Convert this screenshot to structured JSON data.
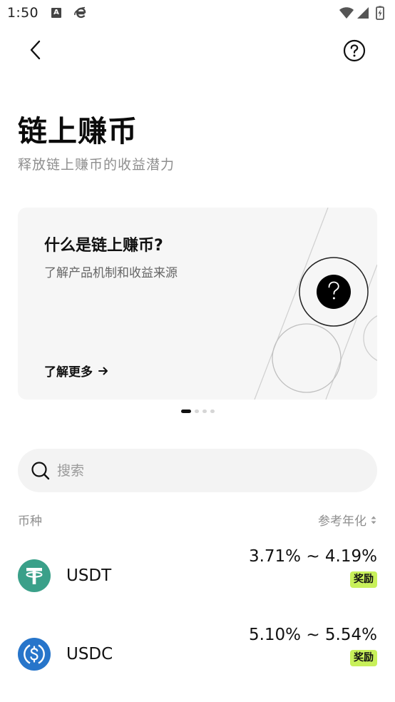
{
  "status_bar": {
    "time": "1:50",
    "notif_icon_letter": "A",
    "icons": [
      "a-app-icon",
      "e-app-icon",
      "wifi-icon",
      "signal-icon",
      "battery-charging-icon"
    ]
  },
  "header": {
    "back_icon": "chevron-left-icon",
    "help_icon": "question-circle-icon"
  },
  "page": {
    "title": "链上赚币",
    "subtitle": "释放链上赚币的收益潜力"
  },
  "banner": {
    "title": "什么是链上赚币?",
    "subtitle": "了解产品机制和收益来源",
    "link_label": "了解更多",
    "slide_count": 4,
    "active_slide": 1
  },
  "search": {
    "placeholder": "搜索",
    "value": ""
  },
  "list": {
    "header_left": "币种",
    "header_right": "参考年化",
    "items": [
      {
        "name": "USDT",
        "apr": "3.71% ~ 4.19%",
        "badge": "奖励",
        "logo_color": "#3aa089",
        "logo_icon": "tether-icon"
      },
      {
        "name": "USDC",
        "apr": "5.10% ~ 5.54%",
        "badge": "奖励",
        "logo_color": "#2775ca",
        "logo_icon": "usdc-icon"
      }
    ]
  },
  "colors": {
    "badge": "#c8f05a",
    "subtle_text": "#8e8e8e",
    "card_bg": "#f6f6f6"
  }
}
